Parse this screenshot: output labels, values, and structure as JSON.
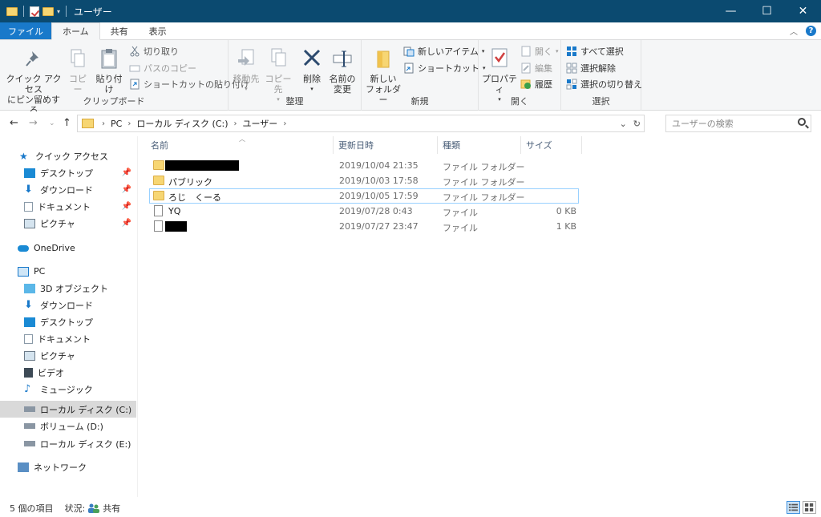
{
  "window": {
    "title": "ユーザー",
    "controls": {
      "minimize": "—",
      "maximize": "☐",
      "close": "✕"
    }
  },
  "ribbon_tabs": {
    "file": "ファイル",
    "home": "ホーム",
    "share": "共有",
    "view": "表示"
  },
  "ribbon": {
    "clipboard": {
      "label": "クリップボード",
      "pin_line1": "クイック アクセス",
      "pin_line2": "にピン留めする",
      "copy": "コピー",
      "paste": "貼り付け",
      "cut": "切り取り",
      "copy_path": "パスのコピー",
      "paste_shortcut": "ショートカットの貼り付け"
    },
    "organize": {
      "label": "整理",
      "move_to": "移動先",
      "copy_to": "コピー先",
      "delete": "削除",
      "rename_line1": "名前の",
      "rename_line2": "変更"
    },
    "new": {
      "label": "新規",
      "new_folder_line1": "新しい",
      "new_folder_line2": "フォルダー",
      "new_item": "新しいアイテム",
      "easy_access": "ショートカット"
    },
    "open": {
      "label": "開く",
      "properties": "プロパティ",
      "open": "開く",
      "edit": "編集",
      "history": "履歴"
    },
    "select": {
      "label": "選択",
      "select_all": "すべて選択",
      "select_none": "選択解除",
      "invert": "選択の切り替え"
    }
  },
  "address": {
    "segments": [
      "PC",
      "ローカル ディスク (C:)",
      "ユーザー"
    ],
    "search_placeholder": "ユーザーの検索"
  },
  "sidebar": {
    "quick_access": "クイック アクセス",
    "quick_items": [
      "デスクトップ",
      "ダウンロード",
      "ドキュメント",
      "ピクチャ"
    ],
    "onedrive": "OneDrive",
    "pc": "PC",
    "pc_items": [
      "3D オブジェクト",
      "ダウンロード",
      "デスクトップ",
      "ドキュメント",
      "ピクチャ",
      "ビデオ",
      "ミュージック",
      "ローカル ディスク (C:)",
      "ボリューム (D:)",
      "ローカル ディスク (E:)"
    ],
    "network": "ネットワーク"
  },
  "columns": {
    "name": "名前",
    "modified": "更新日時",
    "type": "種類",
    "size": "サイズ"
  },
  "files": [
    {
      "name": "",
      "modified": "2019/10/04 21:35",
      "type": "ファイル フォルダー",
      "size": ""
    },
    {
      "name": "パブリック",
      "modified": "2019/10/03 17:58",
      "type": "ファイル フォルダー",
      "size": ""
    },
    {
      "name": "ろじ　くーる",
      "modified": "2019/10/05 17:59",
      "type": "ファイル フォルダー",
      "size": ""
    },
    {
      "name": "YQ",
      "modified": "2019/07/28 0:43",
      "type": "ファイル",
      "size": "0 KB"
    },
    {
      "name": "",
      "modified": "2019/07/27 23:47",
      "type": "ファイル",
      "size": "1 KB"
    }
  ],
  "status": {
    "count": "5 個の項目",
    "state_label": "状況:",
    "state_value": "共有"
  },
  "colors": {
    "titlebar": "#0b4a70",
    "file_tab": "#1979ca",
    "folder": "#f7d673"
  }
}
